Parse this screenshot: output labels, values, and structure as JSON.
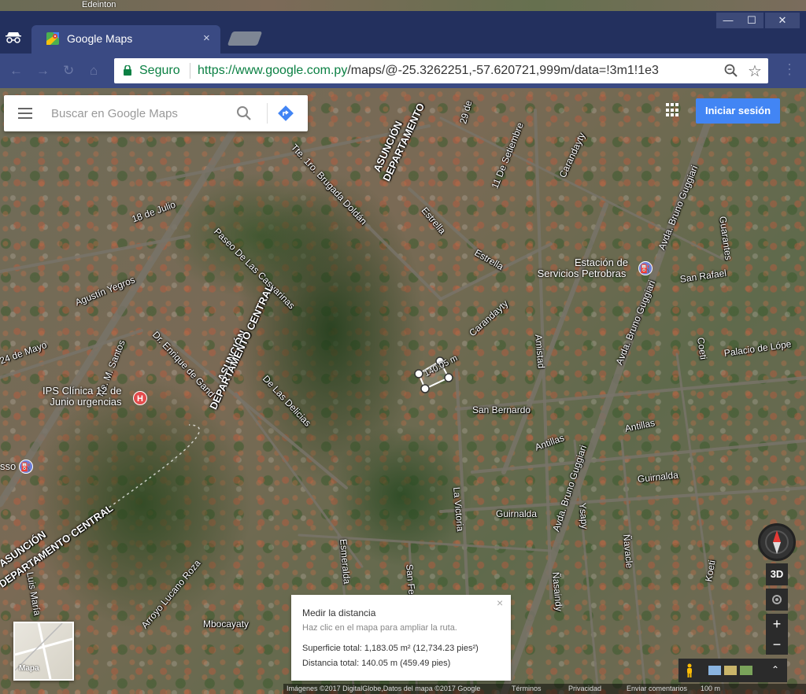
{
  "desktop": {
    "top_labels": [
      "Edeinton"
    ]
  },
  "browser": {
    "tab_title": "Google Maps",
    "tab_close": "×",
    "window_buttons": {
      "minimize": "—",
      "maximize": "☐",
      "close": "✕"
    },
    "secure_label": "Seguro",
    "url_host": "https://www.google.com.py",
    "url_path": "/maps/@-25.3262251,-57.620721,999m/data=!3m1!1e3"
  },
  "maps": {
    "search_placeholder": "Buscar en Google Maps",
    "signin_label": "Iniciar sesión",
    "poi": [
      {
        "label_line1": "Estación de",
        "label_line2": "Servicios Petrobras"
      },
      {
        "label_line1": "IPS Clínica 12 de",
        "label_line2": "Junio urgencias"
      },
      {
        "label_line1": "sso"
      }
    ],
    "streets": [
      "Tte. 1ro. Brugada Doldán",
      "18 de Julio",
      "Paseo De Las Casuarinas",
      "Agustín Yegros",
      "Estrella",
      "Estrella",
      "11 De Setiembre",
      "Carandayty",
      "Carandayty",
      "Avda. Bruno Guggiari",
      "Guarantes",
      "San Rafael",
      "Coeti",
      "Palacio de Lópe",
      "Amistad",
      "Dr. Enrique de Gand",
      "De Las Delicias",
      "San Bernardo",
      "Antillas",
      "Antillas",
      "Guirnalda",
      "Guirnalda",
      "Avda. Bruno Guggiari",
      "La Victoria",
      "Esmeralda",
      "Ysapy",
      "Ñasaindy",
      "Ñavacle",
      "Koeti",
      "Mbocayaty",
      "Tte. M. Santos",
      "24 de Mayo",
      "San Fe",
      "29 de",
      "Luis María",
      "Arroyo Lucano Roza",
      "Avda. Bruno Guggiari"
    ],
    "department_labels": [
      "ASUNCIÓN",
      "DEPARTAMENTO",
      "ASUNCIÓN",
      "DEPARTAMENTO CENTRAL",
      "ASUNCIÓN",
      "DEPARTAMENTO CENTRAL"
    ],
    "measure_label": "140.05 m",
    "measure_card": {
      "title": "Medir la distancia",
      "hint": "Haz clic en el mapa para ampliar la ruta.",
      "area": "Superficie total: 1,183.05 m² (12,734.23 pies²)",
      "distance": "Distancia total: 140.05 m (459.49 pies)",
      "close": "×"
    },
    "layer_label": "Mapa",
    "controls": {
      "three_d": "3D",
      "zoom_in": "+",
      "zoom_out": "−"
    },
    "footer": [
      "Imágenes ©2017 DigitalGlobe,Datos del mapa ©2017 Google",
      "Términos",
      "Privacidad",
      "Enviar comentarios",
      "100 m"
    ]
  }
}
